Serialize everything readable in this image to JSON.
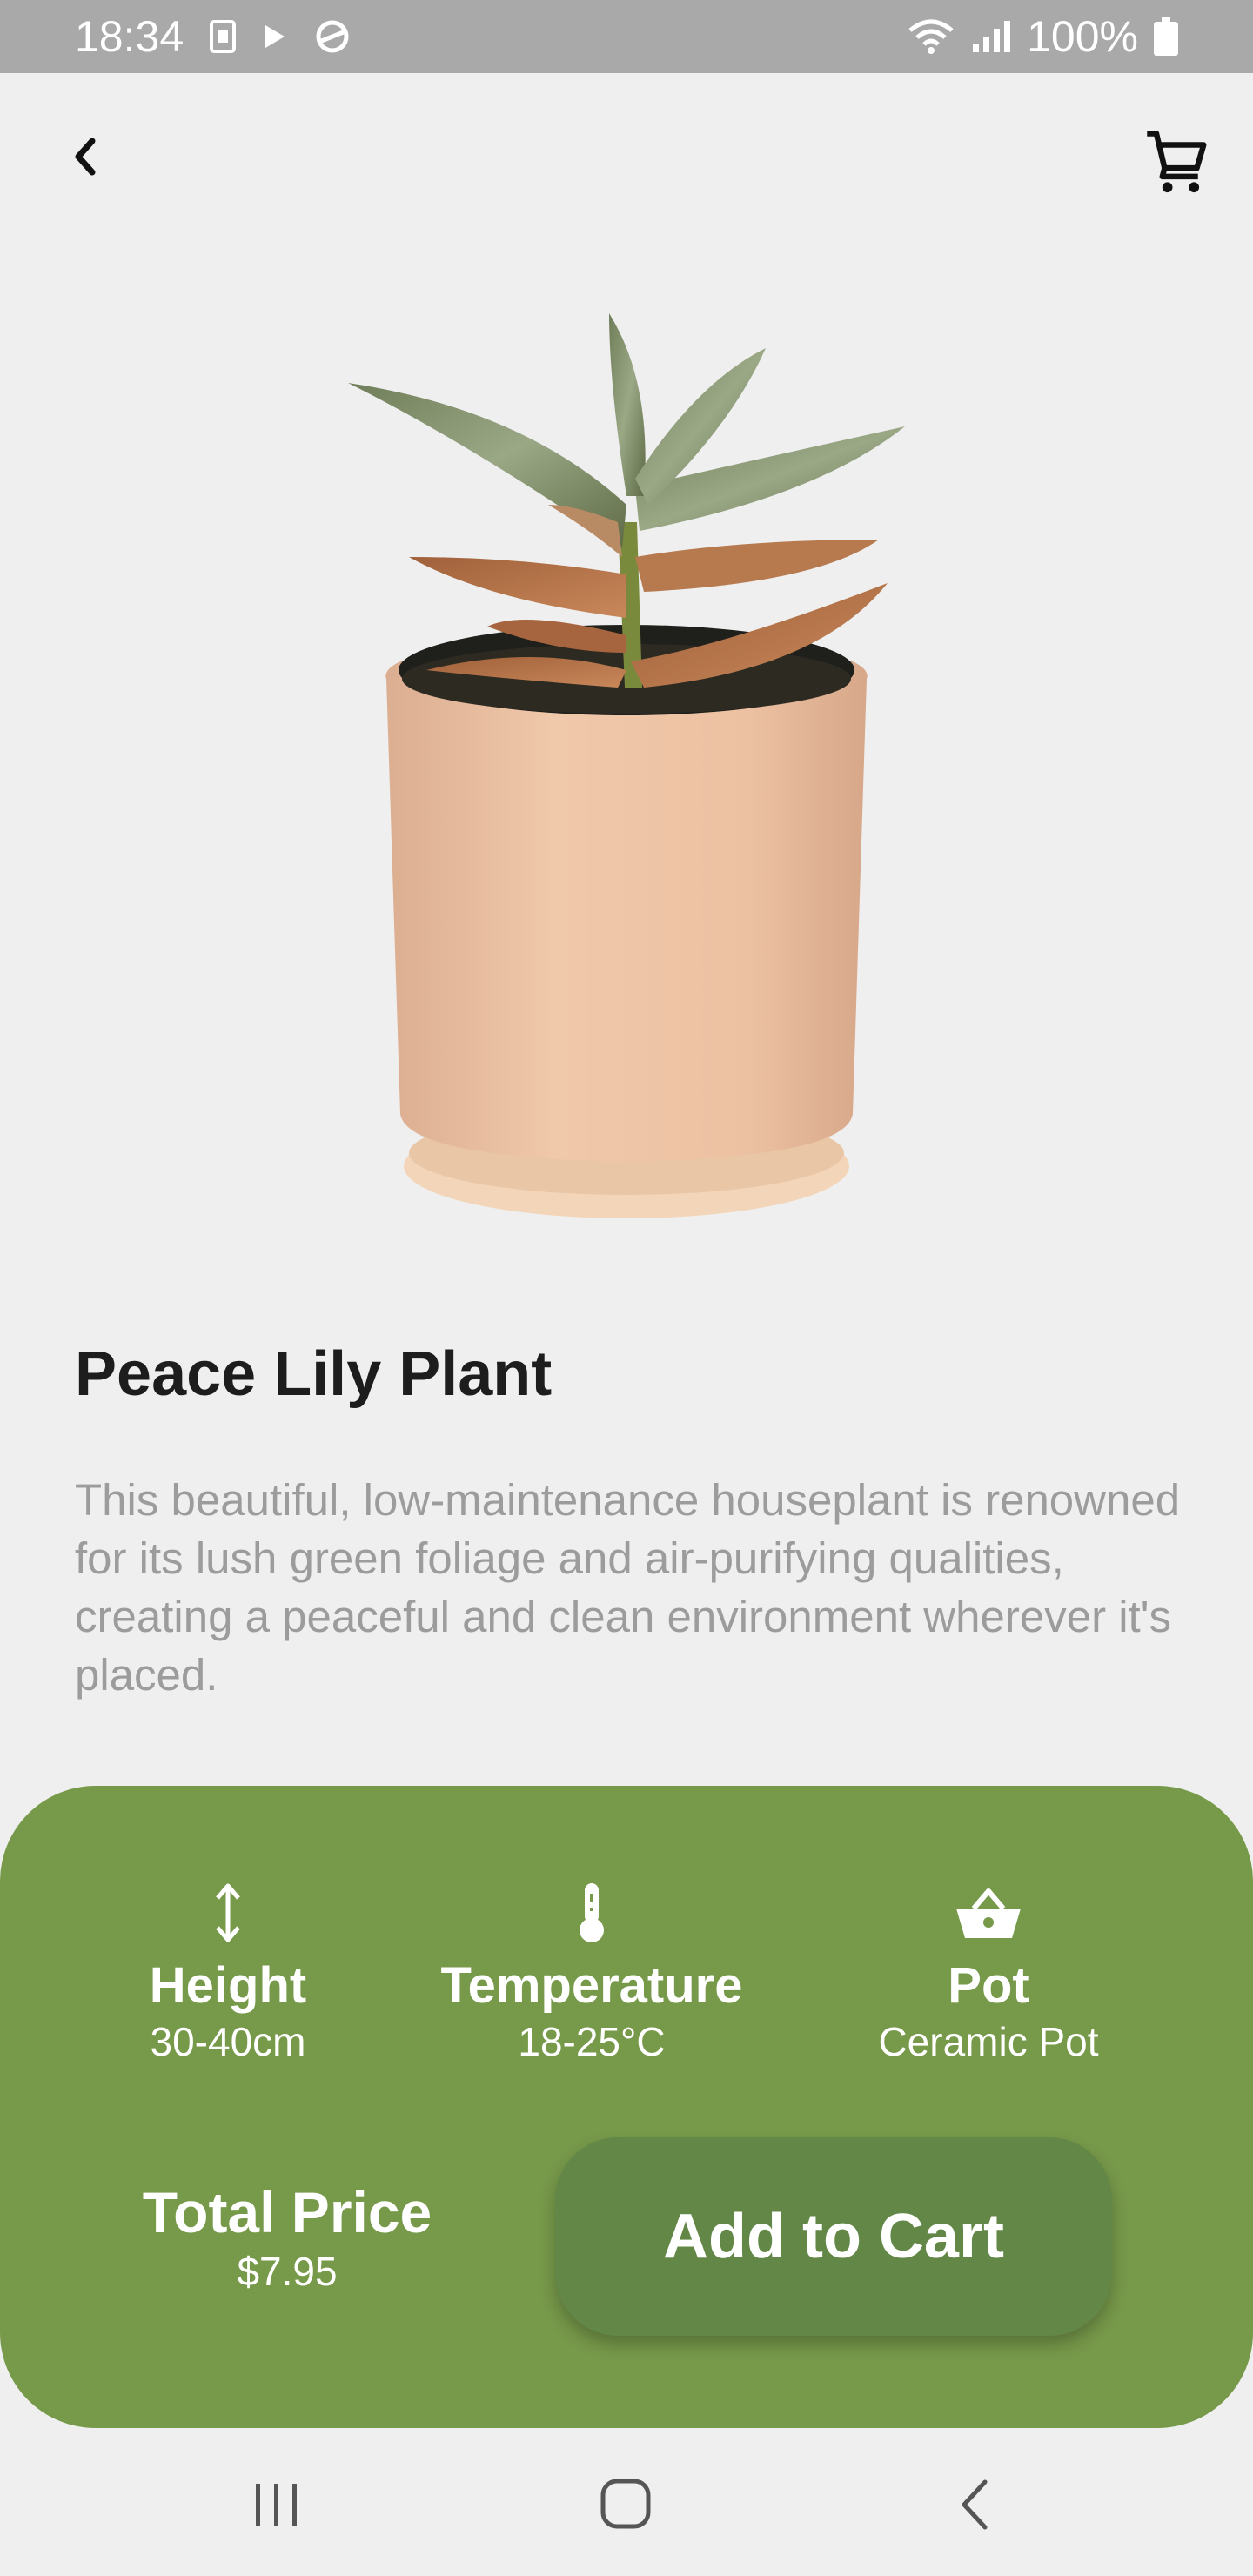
{
  "status_bar": {
    "time": "18:34",
    "battery": "100%",
    "icons": [
      "sim-card-icon",
      "play-icon",
      "sync-icon",
      "wifi-icon",
      "signal-icon",
      "battery-icon"
    ]
  },
  "header": {
    "back_icon": "chevron-left-icon",
    "cart_icon": "shopping-cart-icon"
  },
  "product": {
    "image": "potted-plant-image",
    "title": "Peace Lily Plant",
    "description": "This beautiful, low-maintenance houseplant is renowned for its lush green foliage and air-purifying qualities, creating a peaceful and clean environment wherever it's placed."
  },
  "specs": [
    {
      "icon": "height-arrows-icon",
      "label": "Height",
      "value": "30-40cm"
    },
    {
      "icon": "thermometer-icon",
      "label": "Temperature",
      "value": "18-25°C"
    },
    {
      "icon": "basket-icon",
      "label": "Pot",
      "value": "Ceramic Pot"
    }
  ],
  "purchase": {
    "total_label": "Total Price",
    "total_value": "$7.95",
    "button_label": "Add to Cart"
  },
  "colors": {
    "panel": "#77994a",
    "button": "#638746",
    "background": "#efefef"
  },
  "nav_bar": {
    "icons": [
      "recents-icon",
      "home-icon",
      "back-icon"
    ]
  }
}
